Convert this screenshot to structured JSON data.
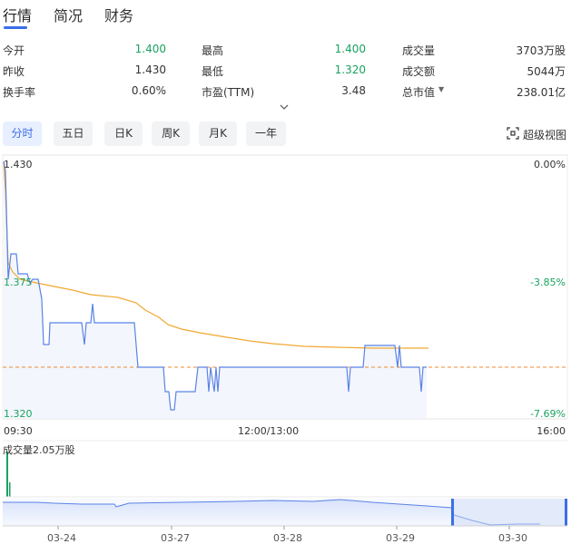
{
  "tabs": [
    {
      "label": "行情",
      "active": true
    },
    {
      "label": "简况",
      "active": false
    },
    {
      "label": "财务",
      "active": false
    }
  ],
  "stats": {
    "open": {
      "label": "今开",
      "value": "1.400"
    },
    "high": {
      "label": "最高",
      "value": "1.400"
    },
    "volume": {
      "label": "成交量",
      "value": "3703万股"
    },
    "prev_close": {
      "label": "昨收",
      "value": "1.430"
    },
    "low": {
      "label": "最低",
      "value": "1.320"
    },
    "amount": {
      "label": "成交额",
      "value": "5044万"
    },
    "turnover": {
      "label": "换手率",
      "value": "0.60%"
    },
    "pe": {
      "label": "市盈(TTM)",
      "value": "3.48"
    },
    "market_cap": {
      "label": "总市值",
      "value": "238.01亿"
    }
  },
  "periods": [
    {
      "label": "分时",
      "active": true
    },
    {
      "label": "五日",
      "active": false
    },
    {
      "label": "日K",
      "active": false
    },
    {
      "label": "周K",
      "active": false
    },
    {
      "label": "月K",
      "active": false
    },
    {
      "label": "一年",
      "active": false
    }
  ],
  "super_view_label": "超级视图",
  "chart": {
    "price_top": "1.430",
    "price_mid": "1.375",
    "price_bottom": "1.320",
    "pct_top": "0.00%",
    "pct_mid": "-3.85%",
    "pct_bottom": "-7.69%",
    "time_start": "09:30",
    "time_mid": "12:00/13:00",
    "time_end": "16:00",
    "volume_label": "成交量2.05万股"
  },
  "overview_dates": [
    "03-24",
    "03-27",
    "03-28",
    "03-29",
    "03-30"
  ],
  "colors": {
    "accent": "#3b6ee8",
    "price_line": "#5b82e6",
    "avg_line": "#f0a830",
    "up": "#1aa260",
    "down": "#e8402a"
  }
}
